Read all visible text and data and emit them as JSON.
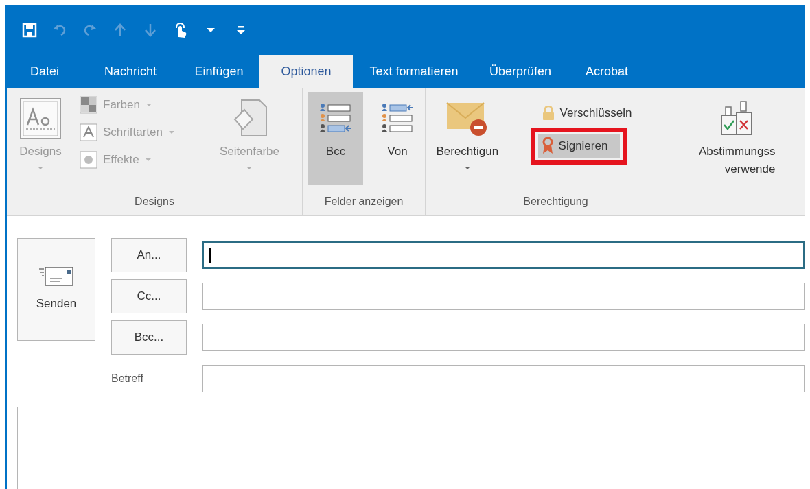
{
  "quick_access": [
    {
      "kind": "save",
      "disabled": false
    },
    {
      "kind": "undo",
      "disabled": true
    },
    {
      "kind": "redo",
      "disabled": true
    },
    {
      "kind": "up",
      "disabled": true
    },
    {
      "kind": "down",
      "disabled": true
    },
    {
      "kind": "touch",
      "disabled": false
    },
    {
      "kind": "dropdown",
      "disabled": false
    },
    {
      "kind": "customize",
      "disabled": false
    }
  ],
  "tabs": [
    {
      "label": "Datei",
      "selected": false
    },
    {
      "label": "Nachricht",
      "selected": false
    },
    {
      "label": "Einfügen",
      "selected": false
    },
    {
      "label": "Optionen",
      "selected": true
    },
    {
      "label": "Text formatieren",
      "selected": false
    },
    {
      "label": "Überprüfen",
      "selected": false
    },
    {
      "label": "Acrobat",
      "selected": false
    }
  ],
  "ribbon_groups": [
    {
      "label": "Designs",
      "items": [
        {
          "kind": "large",
          "label_lines": [
            "Designs"
          ],
          "disabled": true,
          "selected": false,
          "dropdown": true
        },
        {
          "kind": "small_stack",
          "entries": [
            {
              "label": "Farben",
              "disabled": true,
              "selected": false,
              "dropdown": true,
              "outlined": false
            },
            {
              "label": "Schriftarten",
              "disabled": true,
              "selected": false,
              "dropdown": true,
              "outlined": false
            },
            {
              "label": "Effekte",
              "disabled": true,
              "selected": false,
              "dropdown": true,
              "outlined": false
            }
          ]
        },
        {
          "kind": "large",
          "label_lines": [
            "Seitenfarbe"
          ],
          "disabled": true,
          "selected": false,
          "dropdown": true
        }
      ]
    },
    {
      "label": "Felder anzeigen",
      "items": [
        {
          "kind": "large",
          "label_lines": [
            "Bcc"
          ],
          "disabled": false,
          "selected": true,
          "dropdown": false
        },
        {
          "kind": "large",
          "label_lines": [
            "Von"
          ],
          "disabled": false,
          "selected": false,
          "dropdown": false
        }
      ]
    },
    {
      "label": "Berechtigung",
      "items": [
        {
          "kind": "large",
          "label_lines": [
            "Berechtigun"
          ],
          "disabled": false,
          "selected": false,
          "dropdown": true
        },
        {
          "kind": "small_stack",
          "entries": [
            {
              "label": "Verschlüsseln",
              "disabled": false,
              "selected": false,
              "dropdown": false,
              "outlined": false
            },
            {
              "label": "Signieren",
              "disabled": false,
              "selected": true,
              "dropdown": false,
              "outlined": true
            }
          ]
        }
      ]
    },
    {
      "items": [
        {
          "kind": "large",
          "label_lines": [
            "Abstimmungss",
            "verwende"
          ],
          "disabled": false,
          "selected": false,
          "dropdown": false
        }
      ]
    }
  ],
  "compose": {
    "send_button": "Senden",
    "address_rows": [
      {
        "kind": "button",
        "label": "An...",
        "focused": true
      },
      {
        "kind": "button",
        "label": "Cc...",
        "focused": false
      },
      {
        "kind": "button",
        "label": "Bcc...",
        "focused": false
      },
      {
        "kind": "label",
        "label": "Betreff",
        "focused": false
      }
    ]
  }
}
